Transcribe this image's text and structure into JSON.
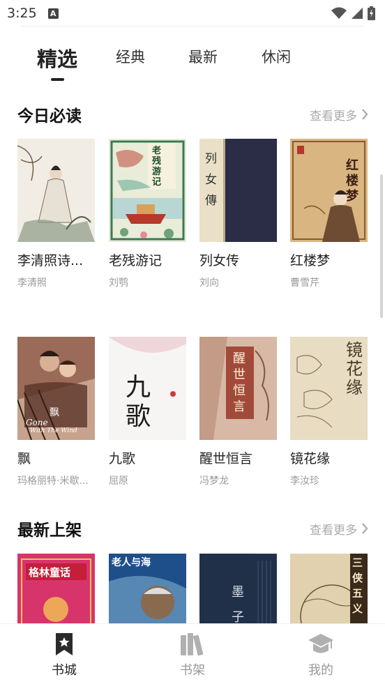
{
  "status_bar": {
    "time": "3:25",
    "notification": "A"
  },
  "tabs": [
    {
      "label": "精选",
      "active": true
    },
    {
      "label": "经典",
      "active": false
    },
    {
      "label": "最新",
      "active": false
    },
    {
      "label": "休闲",
      "active": false
    }
  ],
  "today": {
    "title": "今日必读",
    "more_label": "查看更多",
    "books": [
      {
        "title": "李清照诗...",
        "author": "李清照"
      },
      {
        "title": "老残游记",
        "author": "刘鹗"
      },
      {
        "title": "列女传",
        "author": "刘向"
      },
      {
        "title": "红楼梦",
        "author": "曹雪芹"
      },
      {
        "title": "飘",
        "author": "玛格丽特·米歇..."
      },
      {
        "title": "九歌",
        "author": "屈原"
      },
      {
        "title": "醒世恒言",
        "author": "冯梦龙"
      },
      {
        "title": "镜花缘",
        "author": "李汝珍"
      }
    ]
  },
  "latest": {
    "title": "最新上架",
    "more_label": "查看更多"
  },
  "covers": {
    "laocan": "老残游记",
    "lienv": "列女傳",
    "honglou": "红楼梦",
    "gone_line1": "Gone",
    "gone_line2": "With The Wind",
    "gone_char": "飘",
    "jiuge": "九歌",
    "xingshi": "醒世恒言",
    "jinghua": "镜花缘",
    "grimm": "格林童话",
    "oldman": "老人与海",
    "mozi": "墨子",
    "sanxia": "三侠五义"
  },
  "bottom_nav": [
    {
      "label": "书城",
      "active": true
    },
    {
      "label": "书架",
      "active": false
    },
    {
      "label": "我的",
      "active": false
    }
  ]
}
